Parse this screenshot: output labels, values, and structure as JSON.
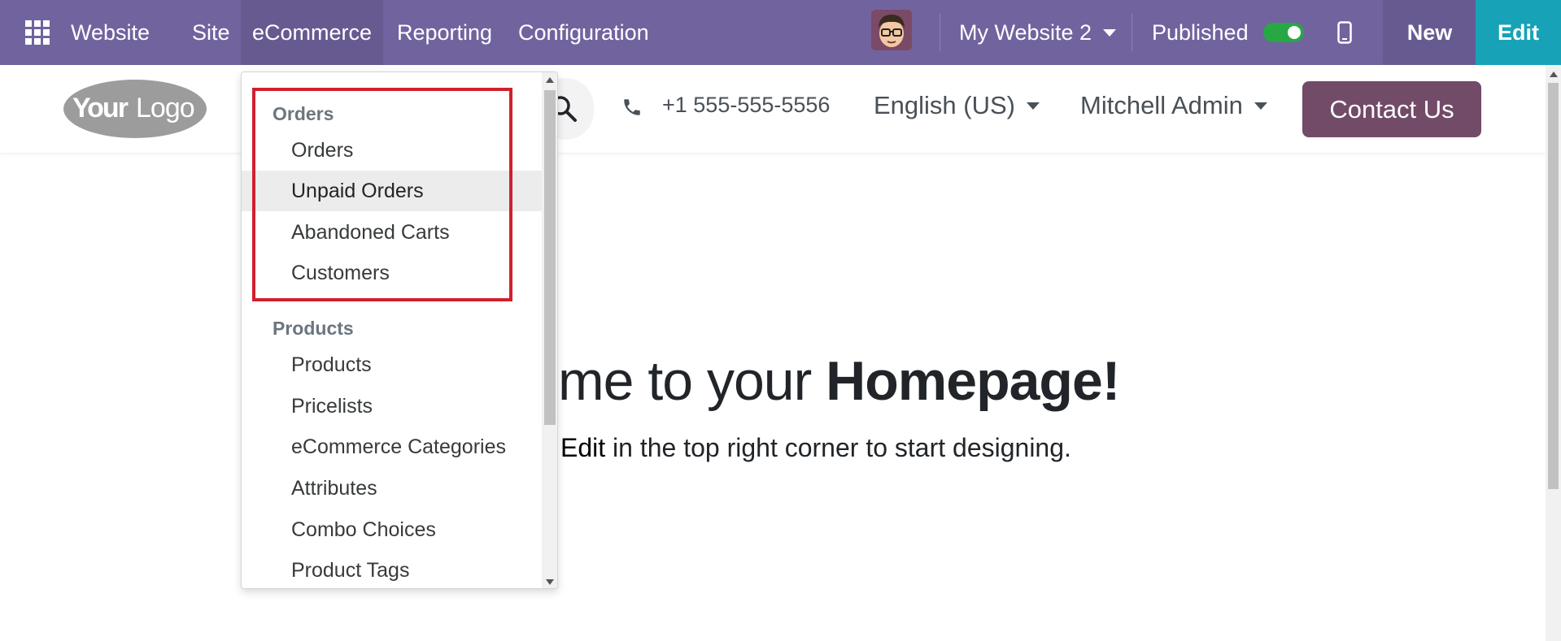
{
  "navbar": {
    "app_name": "Website",
    "menus": [
      "Site",
      "eCommerce",
      "Reporting",
      "Configuration"
    ],
    "website_selector": "My Website 2",
    "published_label": "Published",
    "published": true,
    "new_label": "New",
    "edit_label": "Edit",
    "colors": {
      "bar": "#71639e",
      "edit": "#17a2b8",
      "toggle_on": "#28a745"
    }
  },
  "header": {
    "logo_text": "YourLogo",
    "phone": "+1 555-555-5556",
    "language": "English (US)",
    "user": "Mitchell Admin",
    "contact_label": "Contact Us",
    "contact_color": "#714b67"
  },
  "hero": {
    "title_prefix": "me to your ",
    "title_bold": "Homepage!",
    "subtitle_bold": "Edit",
    "subtitle_rest": " in the top right corner to start designing."
  },
  "dropdown": {
    "orders_header": "Orders",
    "orders_items": [
      "Orders",
      "Unpaid Orders",
      "Abandoned Carts",
      "Customers"
    ],
    "active_item": "Unpaid Orders",
    "products_header": "Products",
    "products_items": [
      "Products",
      "Pricelists",
      "eCommerce Categories",
      "Attributes",
      "Combo Choices",
      "Product Tags"
    ],
    "highlight_color": "#d0202e"
  }
}
